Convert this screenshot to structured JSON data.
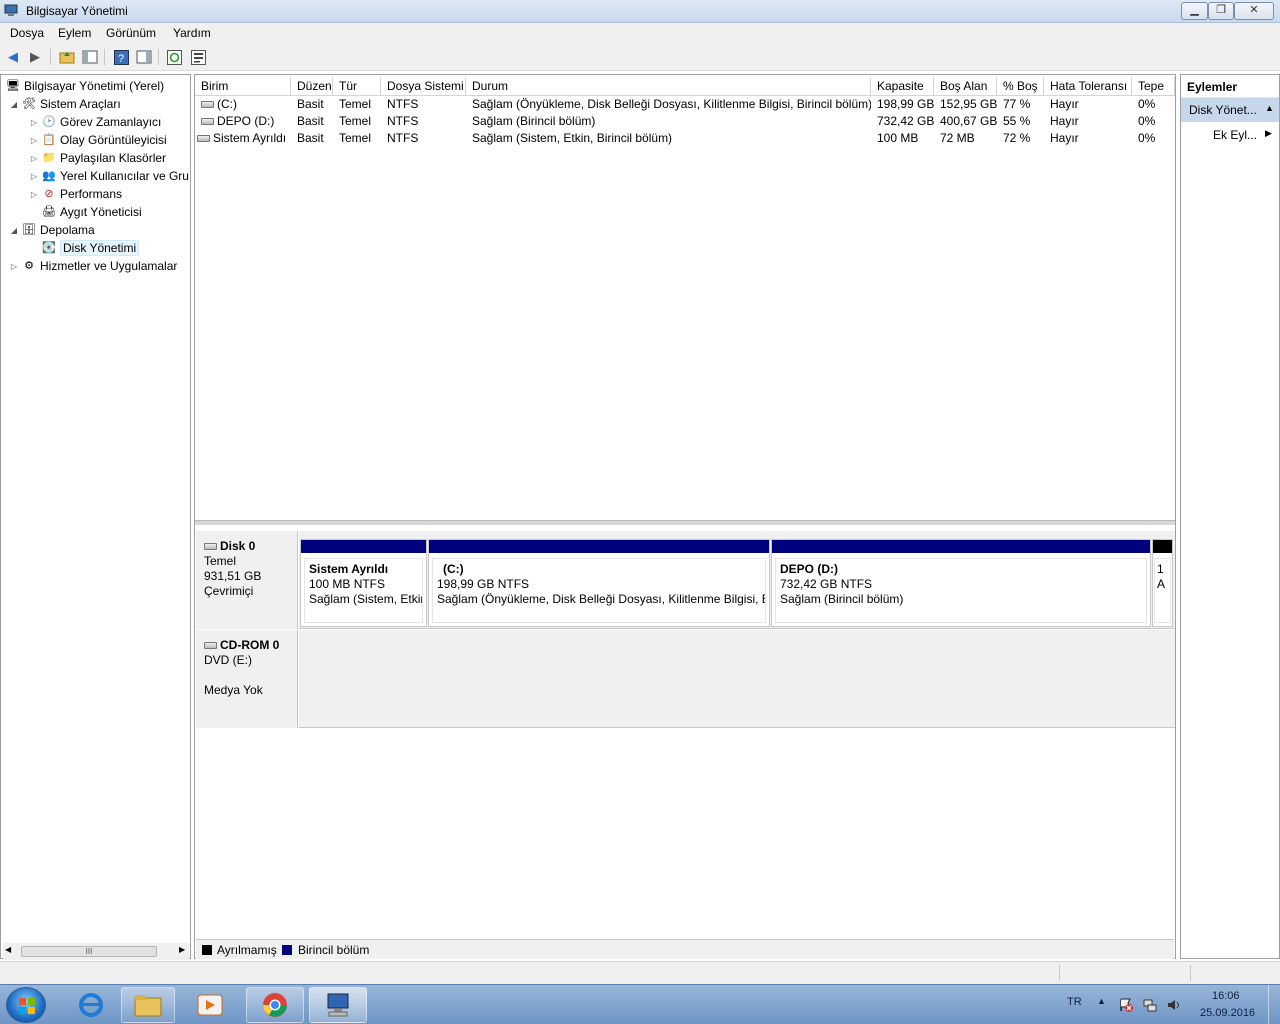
{
  "window": {
    "title": "Bilgisayar Yönetimi",
    "minimize": "▁",
    "maximize": "❐",
    "close": "✕"
  },
  "menu": [
    "Dosya",
    "Eylem",
    "Görünüm",
    "Yardım"
  ],
  "tree": {
    "root": "Bilgisayar Yönetimi (Yerel)",
    "sistem_araclari": "Sistem Araçları",
    "gorev": "Görev Zamanlayıcı",
    "olay": "Olay Görüntüleyicisi",
    "paylasilan": "Paylaşılan Klasörler",
    "yerel": "Yerel Kullanıcılar ve Gru",
    "performans": "Performans",
    "aygit": "Aygıt Yöneticisi",
    "depolama": "Depolama",
    "disk": "Disk Yönetimi",
    "hizmetler": "Hizmetler ve Uygulamalar",
    "scroll_thumb": "III"
  },
  "volumes": {
    "columns": [
      "Birim",
      "Düzen",
      "Tür",
      "Dosya Sistemi",
      "Durum",
      "Kapasite",
      "Boş Alan",
      "% Boş",
      "Hata Toleransı",
      "Tepe"
    ],
    "rows": [
      [
        "(C:)",
        "Basit",
        "Temel",
        "NTFS",
        "Sağlam (Önyükleme, Disk Belleği Dosyası, Kilitlenme Bilgisi, Birincil bölüm)",
        "198,99 GB",
        "152,95 GB",
        "77 %",
        "Hayır",
        "0%"
      ],
      [
        "DEPO (D:)",
        "Basit",
        "Temel",
        "NTFS",
        "Sağlam (Birincil bölüm)",
        "732,42 GB",
        "400,67 GB",
        "55 %",
        "Hayır",
        "0%"
      ],
      [
        "Sistem Ayrıldı",
        "Basit",
        "Temel",
        "NTFS",
        "Sağlam (Sistem, Etkin, Birincil bölüm)",
        "100 MB",
        "72 MB",
        "72 %",
        "Hayır",
        "0%"
      ]
    ]
  },
  "disks": {
    "disk0": {
      "name": "Disk 0",
      "type": "Temel",
      "size": "931,51 GB",
      "status": "Çevrimiçi"
    },
    "partitions": [
      {
        "name": "Sistem Ayrıldı",
        "size": "100 MB NTFS",
        "status": "Sağlam (Sistem, Etkin"
      },
      {
        "name": "(C:)",
        "size": "198,99 GB NTFS",
        "status": "Sağlam (Önyükleme, Disk Belleği Dosyası, Kilitlenme Bilgisi, Bi"
      },
      {
        "name": "DEPO  (D:)",
        "size": "732,42 GB NTFS",
        "status": "Sağlam (Birincil bölüm)"
      },
      {
        "name": "",
        "size": "1",
        "status": "A"
      }
    ],
    "cdrom": {
      "name": "CD-ROM 0",
      "type": "DVD (E:)",
      "status": "Medya Yok"
    }
  },
  "legend": {
    "unallocated": "Ayrılmamış",
    "primary": "Birincil bölüm"
  },
  "actions": {
    "title": "Eylemler",
    "section": "Disk Yönet...",
    "more": "Ek Eyl..."
  },
  "taskbar": {
    "lang": "TR",
    "time": "16:06",
    "date": "25.09.2016"
  },
  "colors": {
    "primary_partition": "#00007f",
    "unallocated": "#000000",
    "selection": "#c6d7ec"
  }
}
